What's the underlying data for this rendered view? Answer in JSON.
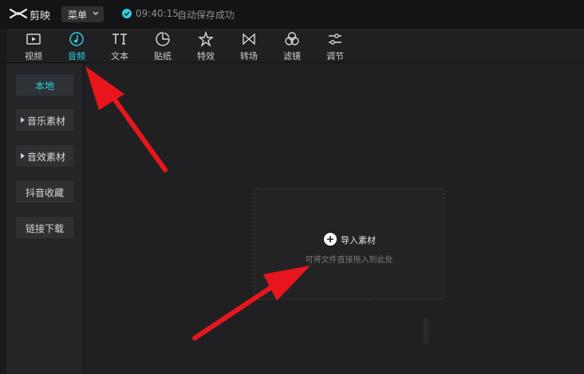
{
  "app": {
    "name": "剪映",
    "menu_label": "菜单",
    "save_time": "09:40:15",
    "save_status": "自动保存成功"
  },
  "tabs": [
    {
      "label": "视频",
      "icon": "video-icon",
      "active": false
    },
    {
      "label": "音频",
      "icon": "audio-icon",
      "active": true
    },
    {
      "label": "文本",
      "icon": "text-icon",
      "active": false
    },
    {
      "label": "贴纸",
      "icon": "sticker-icon",
      "active": false
    },
    {
      "label": "特效",
      "icon": "effects-icon",
      "active": false
    },
    {
      "label": "转场",
      "icon": "transition-icon",
      "active": false
    },
    {
      "label": "滤镜",
      "icon": "filter-icon",
      "active": false
    },
    {
      "label": "调节",
      "icon": "adjust-icon",
      "active": false
    }
  ],
  "sidebar": {
    "items": [
      {
        "label": "本地",
        "active": true
      },
      {
        "label": "音乐素材",
        "expandable": true
      },
      {
        "label": "音效素材",
        "expandable": true
      },
      {
        "label": "抖音收藏"
      },
      {
        "label": "链接下载"
      }
    ]
  },
  "drop_zone": {
    "import_label": "导入素材",
    "hint": "可将文件直接拖入到此处"
  },
  "colors": {
    "accent": "#2fcfe0",
    "annotation_arrow": "#e8161c"
  }
}
